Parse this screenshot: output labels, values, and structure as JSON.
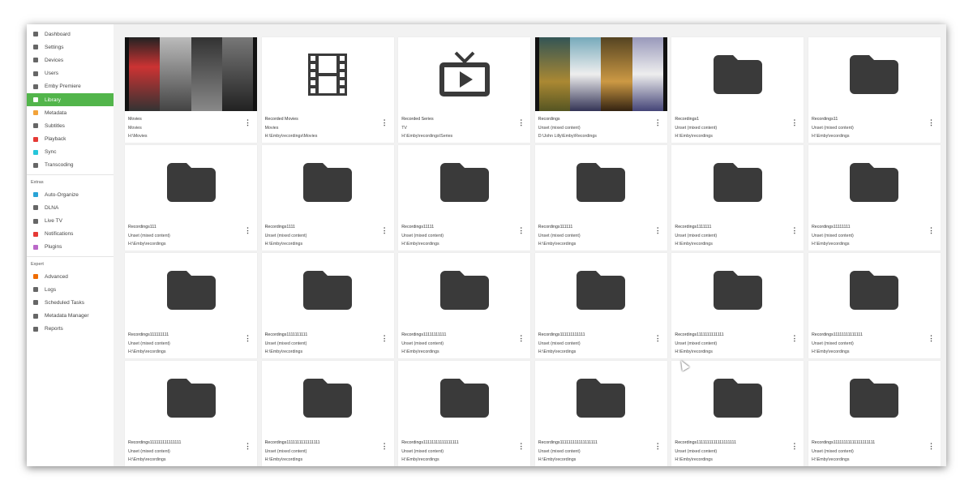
{
  "sidebar": {
    "items": [
      {
        "label": "Dashboard",
        "icon": "dashboard-icon",
        "color": "#666"
      },
      {
        "label": "Settings",
        "icon": "gear-icon",
        "color": "#666"
      },
      {
        "label": "Devices",
        "icon": "devices-icon",
        "color": "#666"
      },
      {
        "label": "Users",
        "icon": "users-icon",
        "color": "#666"
      },
      {
        "label": "Emby Premiere",
        "icon": "star-icon",
        "color": "#666"
      },
      {
        "label": "Library",
        "icon": "folder-icon",
        "color": "#fff",
        "active": true
      },
      {
        "label": "Metadata",
        "icon": "file-icon",
        "color": "#f2a33a"
      },
      {
        "label": "Subtitles",
        "icon": "subtitles-icon",
        "color": "#666"
      },
      {
        "label": "Playback",
        "icon": "play-circle-icon",
        "color": "#e53935"
      },
      {
        "label": "Sync",
        "icon": "sync-icon",
        "color": "#26c6da"
      },
      {
        "label": "Transcoding",
        "icon": "transcode-icon",
        "color": "#666"
      }
    ],
    "extras_heading": "Extras",
    "extras": [
      {
        "label": "Auto-Organize",
        "icon": "folder-icon",
        "color": "#29a3d6"
      },
      {
        "label": "DLNA",
        "icon": "gear-icon",
        "color": "#666"
      },
      {
        "label": "Live TV",
        "icon": "tv-icon",
        "color": "#666"
      },
      {
        "label": "Notifications",
        "icon": "bell-icon",
        "color": "#e53935"
      },
      {
        "label": "Plugins",
        "icon": "plugin-icon",
        "color": "#ba68c8"
      }
    ],
    "expert_heading": "Expert",
    "expert": [
      {
        "label": "Advanced",
        "icon": "gear-icon",
        "color": "#ef6c00"
      },
      {
        "label": "Logs",
        "icon": "folder-outline-icon",
        "color": "#666"
      },
      {
        "label": "Scheduled Tasks",
        "icon": "clock-icon",
        "color": "#666"
      },
      {
        "label": "Metadata Manager",
        "icon": "edit-icon",
        "color": "#666"
      },
      {
        "label": "Reports",
        "icon": "report-icon",
        "color": "#666"
      }
    ]
  },
  "libraries": [
    {
      "name": "Movies",
      "type": "Movies",
      "path": "H:\\Movies",
      "image": "posters"
    },
    {
      "name": "Recorded Movies",
      "type": "Movies",
      "path": "H:\\Emby\\recordings\\Movies",
      "image": "film"
    },
    {
      "name": "Recorded Series",
      "type": "TV",
      "path": "H:\\Emby\\recordings\\Series",
      "image": "tv"
    },
    {
      "name": "Recordings",
      "type": "Unset (mixed content)",
      "path": "D:\\John Lilly\\Emby\\Recordings",
      "image": "posters2"
    },
    {
      "name": "Recordings1",
      "type": "Unset (mixed content)",
      "path": "H:\\Emby\\recordings",
      "image": "folder"
    },
    {
      "name": "Recordings11",
      "type": "Unset (mixed content)",
      "path": "H:\\Emby\\recordings",
      "image": "folder"
    },
    {
      "name": "Recordings111",
      "type": "Unset (mixed content)",
      "path": "H:\\Emby\\recordings",
      "image": "folder"
    },
    {
      "name": "Recordings1111",
      "type": "Unset (mixed content)",
      "path": "H:\\Emby\\recordings",
      "image": "folder"
    },
    {
      "name": "Recordings11111",
      "type": "Unset (mixed content)",
      "path": "H:\\Emby\\recordings",
      "image": "folder"
    },
    {
      "name": "Recordings111111",
      "type": "Unset (mixed content)",
      "path": "H:\\Emby\\recordings",
      "image": "folder"
    },
    {
      "name": "Recordings1111111",
      "type": "Unset (mixed content)",
      "path": "H:\\Emby\\recordings",
      "image": "folder"
    },
    {
      "name": "Recordings11111111",
      "type": "Unset (mixed content)",
      "path": "H:\\Emby\\recordings",
      "image": "folder"
    },
    {
      "name": "Recordings111111111",
      "type": "Unset (mixed content)",
      "path": "H:\\Emby\\recordings",
      "image": "folder"
    },
    {
      "name": "Recordings1111111111",
      "type": "Unset (mixed content)",
      "path": "H:\\Emby\\recordings",
      "image": "folder"
    },
    {
      "name": "Recordings11111111111",
      "type": "Unset (mixed content)",
      "path": "H:\\Emby\\recordings",
      "image": "folder"
    },
    {
      "name": "Recordings111111111111",
      "type": "Unset (mixed content)",
      "path": "H:\\Emby\\recordings",
      "image": "folder"
    },
    {
      "name": "Recordings1111111111111",
      "type": "Unset (mixed content)",
      "path": "H:\\Emby\\recordings",
      "image": "folder"
    },
    {
      "name": "Recordings11111111111111",
      "type": "Unset (mixed content)",
      "path": "H:\\Emby\\recordings",
      "image": "folder"
    },
    {
      "name": "Recordings111111111111111",
      "type": "Unset (mixed content)",
      "path": "H:\\Emby\\recordings",
      "image": "folder"
    },
    {
      "name": "Recordings1111111111111111",
      "type": "Unset (mixed content)",
      "path": "H:\\Emby\\recordings",
      "image": "folder"
    },
    {
      "name": "Recordings11111111111111111",
      "type": "Unset (mixed content)",
      "path": "H:\\Emby\\recordings",
      "image": "folder"
    },
    {
      "name": "Recordings111111111111111111",
      "type": "Unset (mixed content)",
      "path": "H:\\Emby\\recordings",
      "image": "folder"
    },
    {
      "name": "Recordings1111111111111111111",
      "type": "Unset (mixed content)",
      "path": "H:\\Emby\\recordings",
      "image": "folder"
    },
    {
      "name": "Recordings11111111111111111111",
      "type": "Unset (mixed content)",
      "path": "H:\\Emby\\recordings",
      "image": "folder"
    }
  ]
}
